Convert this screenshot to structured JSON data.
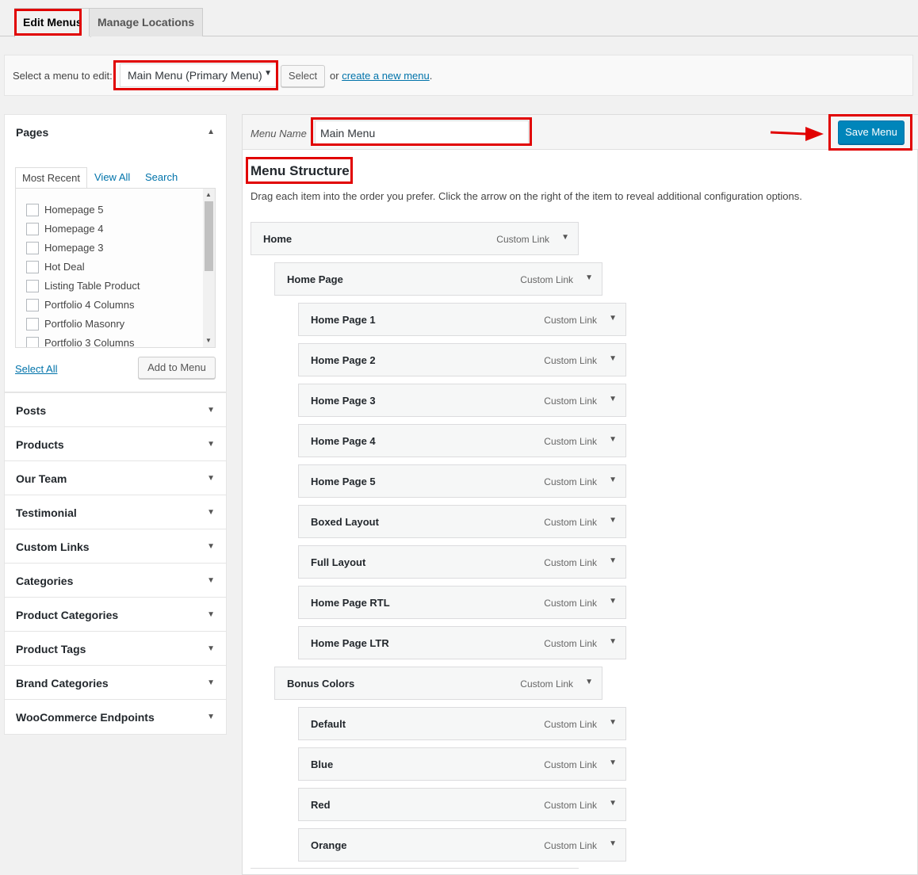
{
  "tabs": [
    {
      "label": "Edit Menus",
      "active": true
    },
    {
      "label": "Manage Locations",
      "active": false
    }
  ],
  "select_bar": {
    "label": "Select a menu to edit:",
    "selected_menu": "Main Menu (Primary Menu)",
    "select_button": "Select",
    "or_text": "or",
    "create_link": "create a new menu",
    "period": "."
  },
  "pages_panel": {
    "title": "Pages",
    "tabs": [
      "Most Recent",
      "View All",
      "Search"
    ],
    "items": [
      "Homepage 5",
      "Homepage 4",
      "Homepage 3",
      "Hot Deal",
      "Listing Table Product",
      "Portfolio 4 Columns",
      "Portfolio Masonry",
      "Portfolio 3 Columns"
    ],
    "select_all": "Select All",
    "add_button": "Add to Menu"
  },
  "sections": [
    "Posts",
    "Products",
    "Our Team",
    "Testimonial",
    "Custom Links",
    "Categories",
    "Product Categories",
    "Product Tags",
    "Brand Categories",
    "WooCommerce Endpoints"
  ],
  "menu_editor": {
    "name_label": "Menu Name",
    "name_value": "Main Menu",
    "save_button": "Save Menu",
    "structure_title": "Menu Structure",
    "structure_desc": "Drag each item into the order you prefer. Click the arrow on the right of the item to reveal additional configuration options.",
    "items": [
      {
        "title": "Home",
        "type": "Custom Link",
        "depth": 0
      },
      {
        "title": "Home Page",
        "type": "Custom Link",
        "depth": 1
      },
      {
        "title": "Home Page 1",
        "type": "Custom Link",
        "depth": 2
      },
      {
        "title": "Home Page 2",
        "type": "Custom Link",
        "depth": 2
      },
      {
        "title": "Home Page 3",
        "type": "Custom Link",
        "depth": 2
      },
      {
        "title": "Home Page 4",
        "type": "Custom Link",
        "depth": 2
      },
      {
        "title": "Home Page 5",
        "type": "Custom Link",
        "depth": 2
      },
      {
        "title": "Boxed Layout",
        "type": "Custom Link",
        "depth": 2
      },
      {
        "title": "Full Layout",
        "type": "Custom Link",
        "depth": 2
      },
      {
        "title": "Home Page RTL",
        "type": "Custom Link",
        "depth": 2
      },
      {
        "title": "Home Page LTR",
        "type": "Custom Link",
        "depth": 2
      },
      {
        "title": "Bonus Colors",
        "type": "Custom Link",
        "depth": 1
      },
      {
        "title": "Default",
        "type": "Custom Link",
        "depth": 2
      },
      {
        "title": "Blue",
        "type": "Custom Link",
        "depth": 2
      },
      {
        "title": "Red",
        "type": "Custom Link",
        "depth": 2
      },
      {
        "title": "Orange",
        "type": "Custom Link",
        "depth": 2
      }
    ]
  },
  "colors": {
    "annotation": "#e10000",
    "primary_button": "#0085ba",
    "link": "#0073aa"
  },
  "icons": {
    "collapse": "triangle-up-icon",
    "expand": "triangle-down-icon",
    "annotation_arrow": "red-arrow-icon"
  }
}
